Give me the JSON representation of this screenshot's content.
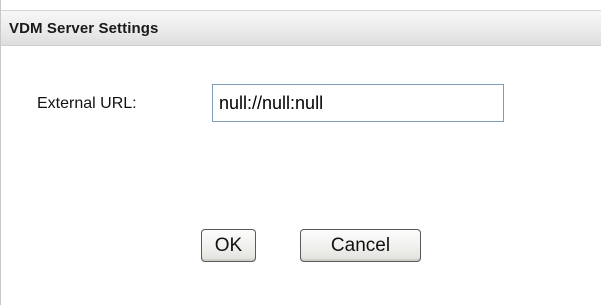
{
  "dialog": {
    "title": "VDM Server Settings"
  },
  "form": {
    "external_url_label": "External URL:",
    "external_url_value": "null://null:null"
  },
  "actions": {
    "ok_label": "OK",
    "cancel_label": "Cancel"
  }
}
